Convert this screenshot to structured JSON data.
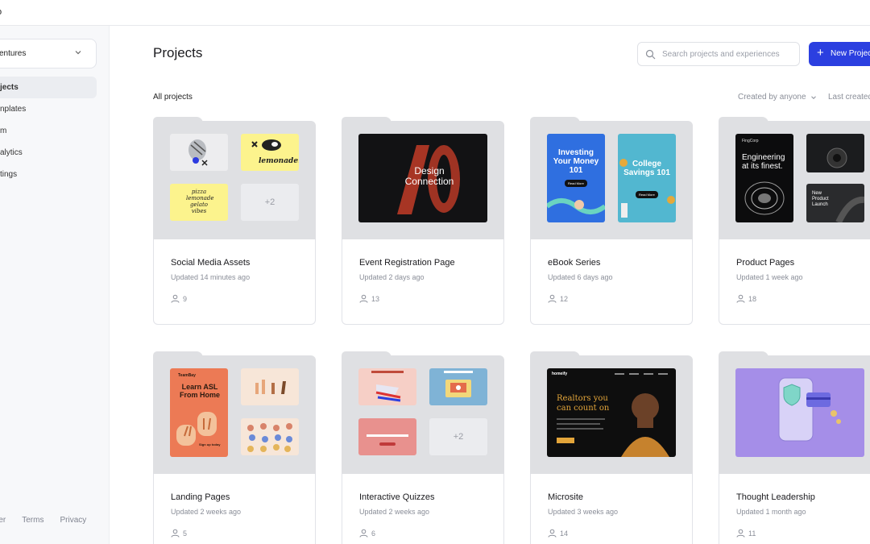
{
  "app": {
    "brand": "o"
  },
  "sidebar": {
    "workspace": "entures",
    "items": [
      {
        "label": "jects",
        "active": true
      },
      {
        "label": "nplates",
        "active": false
      },
      {
        "label": "m",
        "active": false
      },
      {
        "label": "alytics",
        "active": false
      },
      {
        "label": "tings",
        "active": false
      }
    ],
    "footer": {
      "center": "nter",
      "terms": "Terms",
      "privacy": "Privacy"
    }
  },
  "header": {
    "title": "Projects",
    "search_placeholder": "Search projects and experiences",
    "new_button": "New Project"
  },
  "toolbar": {
    "section": "All projects",
    "filter_creator": "Created by anyone",
    "filter_sort": "Last created"
  },
  "colors": {
    "accent": "#2b3fe0"
  },
  "thumbs": {
    "lemonade": "lemonade.",
    "pizza": "pizza lemonade gelato vibes",
    "more": "+2",
    "design": "Design Connection",
    "ebook1": "Investing Your Money 101",
    "ebook2": "College Savings 101",
    "read_more": "Read More",
    "prod_brand": "FingCorp",
    "prod1": "Engineering at its finest.",
    "prod2": "New Product Launch",
    "asl_brand": "TeamBay",
    "asl": "Learn ASL From Home",
    "asl_btn": "Sign up today",
    "realtors": "Realtors you can count on",
    "homeify": "homeify"
  },
  "projects": [
    {
      "title": "Social Media Assets",
      "updated": "Updated 14 minutes ago",
      "members": "9"
    },
    {
      "title": "Event Registration Page",
      "updated": "Updated 2 days ago",
      "members": "13"
    },
    {
      "title": "eBook Series",
      "updated": "Updated 6 days ago",
      "members": "12"
    },
    {
      "title": "Product Pages",
      "updated": "Updated 1 week ago",
      "members": "18"
    },
    {
      "title": "Landing Pages",
      "updated": "Updated 2 weeks ago",
      "members": "5"
    },
    {
      "title": "Interactive Quizzes",
      "updated": "Updated 2 weeks ago",
      "members": "6"
    },
    {
      "title": "Microsite",
      "updated": "Updated 3 weeks ago",
      "members": "14"
    },
    {
      "title": "Thought Leadership",
      "updated": "Updated 1 month ago",
      "members": "11"
    }
  ]
}
